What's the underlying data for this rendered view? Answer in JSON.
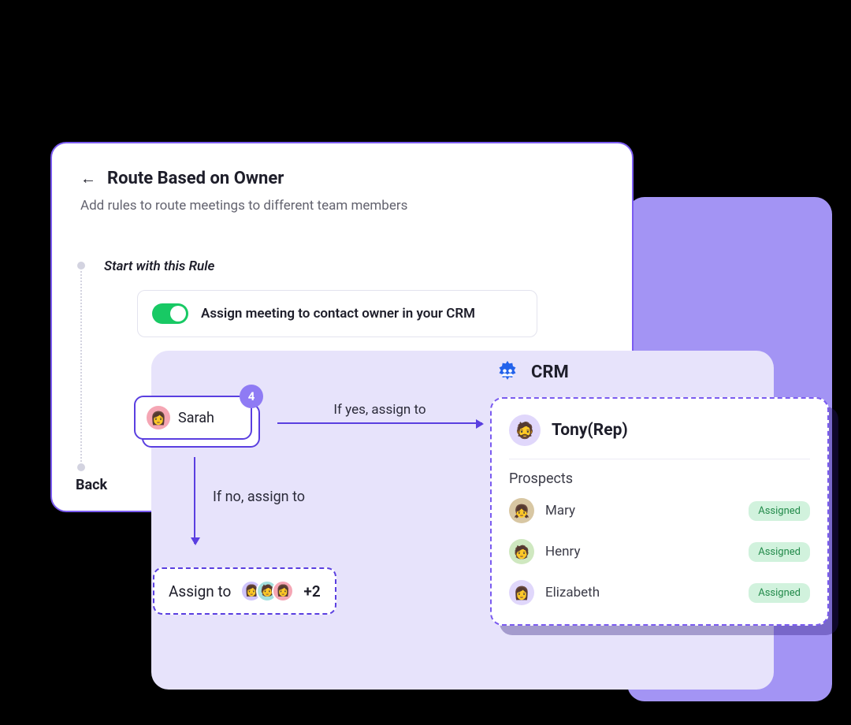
{
  "rule": {
    "title": "Route Based on Owner",
    "subtitle": "Add rules to route meetings to different team members",
    "section_label": "Start with this Rule",
    "toggle_label": "Assign meeting to contact owner in your CRM",
    "back_label": "Back"
  },
  "contact": {
    "name": "Sarah",
    "badge": "4"
  },
  "flow": {
    "yes_label": "If yes, assign to",
    "no_label": "If no, assign to"
  },
  "assign": {
    "label": "Assign to",
    "extra": "+2"
  },
  "crm": {
    "title": "CRM",
    "rep_name": "Tony(Rep)",
    "prospects_label": "Prospects",
    "prospects": [
      {
        "name": "Mary",
        "status": "Assigned"
      },
      {
        "name": "Henry",
        "status": "Assigned"
      },
      {
        "name": "Elizabeth",
        "status": "Assigned"
      }
    ]
  }
}
